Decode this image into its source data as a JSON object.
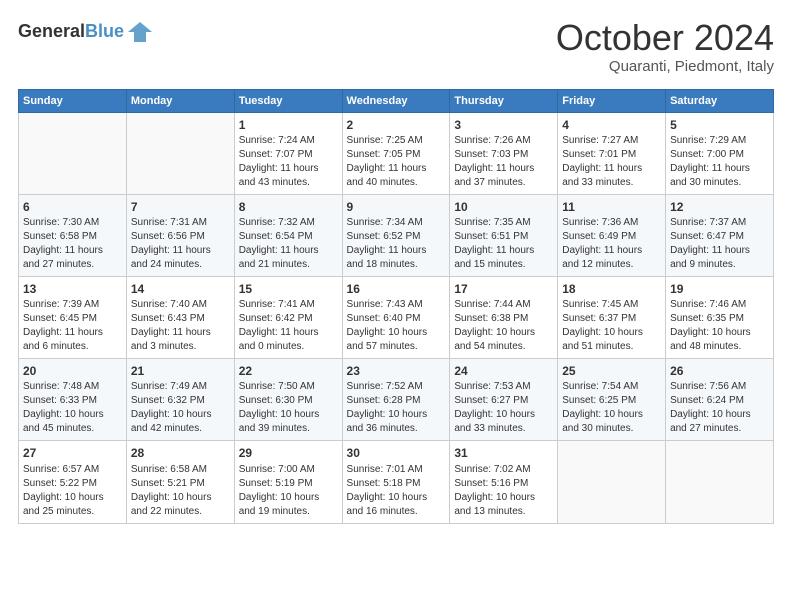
{
  "header": {
    "logo_line1": "General",
    "logo_line2": "Blue",
    "month": "October 2024",
    "location": "Quaranti, Piedmont, Italy"
  },
  "weekdays": [
    "Sunday",
    "Monday",
    "Tuesday",
    "Wednesday",
    "Thursday",
    "Friday",
    "Saturday"
  ],
  "weeks": [
    [
      {
        "day": "",
        "info": ""
      },
      {
        "day": "",
        "info": ""
      },
      {
        "day": "1",
        "info": "Sunrise: 7:24 AM\nSunset: 7:07 PM\nDaylight: 11 hours\nand 43 minutes."
      },
      {
        "day": "2",
        "info": "Sunrise: 7:25 AM\nSunset: 7:05 PM\nDaylight: 11 hours\nand 40 minutes."
      },
      {
        "day": "3",
        "info": "Sunrise: 7:26 AM\nSunset: 7:03 PM\nDaylight: 11 hours\nand 37 minutes."
      },
      {
        "day": "4",
        "info": "Sunrise: 7:27 AM\nSunset: 7:01 PM\nDaylight: 11 hours\nand 33 minutes."
      },
      {
        "day": "5",
        "info": "Sunrise: 7:29 AM\nSunset: 7:00 PM\nDaylight: 11 hours\nand 30 minutes."
      }
    ],
    [
      {
        "day": "6",
        "info": "Sunrise: 7:30 AM\nSunset: 6:58 PM\nDaylight: 11 hours\nand 27 minutes."
      },
      {
        "day": "7",
        "info": "Sunrise: 7:31 AM\nSunset: 6:56 PM\nDaylight: 11 hours\nand 24 minutes."
      },
      {
        "day": "8",
        "info": "Sunrise: 7:32 AM\nSunset: 6:54 PM\nDaylight: 11 hours\nand 21 minutes."
      },
      {
        "day": "9",
        "info": "Sunrise: 7:34 AM\nSunset: 6:52 PM\nDaylight: 11 hours\nand 18 minutes."
      },
      {
        "day": "10",
        "info": "Sunrise: 7:35 AM\nSunset: 6:51 PM\nDaylight: 11 hours\nand 15 minutes."
      },
      {
        "day": "11",
        "info": "Sunrise: 7:36 AM\nSunset: 6:49 PM\nDaylight: 11 hours\nand 12 minutes."
      },
      {
        "day": "12",
        "info": "Sunrise: 7:37 AM\nSunset: 6:47 PM\nDaylight: 11 hours\nand 9 minutes."
      }
    ],
    [
      {
        "day": "13",
        "info": "Sunrise: 7:39 AM\nSunset: 6:45 PM\nDaylight: 11 hours\nand 6 minutes."
      },
      {
        "day": "14",
        "info": "Sunrise: 7:40 AM\nSunset: 6:43 PM\nDaylight: 11 hours\nand 3 minutes."
      },
      {
        "day": "15",
        "info": "Sunrise: 7:41 AM\nSunset: 6:42 PM\nDaylight: 11 hours\nand 0 minutes."
      },
      {
        "day": "16",
        "info": "Sunrise: 7:43 AM\nSunset: 6:40 PM\nDaylight: 10 hours\nand 57 minutes."
      },
      {
        "day": "17",
        "info": "Sunrise: 7:44 AM\nSunset: 6:38 PM\nDaylight: 10 hours\nand 54 minutes."
      },
      {
        "day": "18",
        "info": "Sunrise: 7:45 AM\nSunset: 6:37 PM\nDaylight: 10 hours\nand 51 minutes."
      },
      {
        "day": "19",
        "info": "Sunrise: 7:46 AM\nSunset: 6:35 PM\nDaylight: 10 hours\nand 48 minutes."
      }
    ],
    [
      {
        "day": "20",
        "info": "Sunrise: 7:48 AM\nSunset: 6:33 PM\nDaylight: 10 hours\nand 45 minutes."
      },
      {
        "day": "21",
        "info": "Sunrise: 7:49 AM\nSunset: 6:32 PM\nDaylight: 10 hours\nand 42 minutes."
      },
      {
        "day": "22",
        "info": "Sunrise: 7:50 AM\nSunset: 6:30 PM\nDaylight: 10 hours\nand 39 minutes."
      },
      {
        "day": "23",
        "info": "Sunrise: 7:52 AM\nSunset: 6:28 PM\nDaylight: 10 hours\nand 36 minutes."
      },
      {
        "day": "24",
        "info": "Sunrise: 7:53 AM\nSunset: 6:27 PM\nDaylight: 10 hours\nand 33 minutes."
      },
      {
        "day": "25",
        "info": "Sunrise: 7:54 AM\nSunset: 6:25 PM\nDaylight: 10 hours\nand 30 minutes."
      },
      {
        "day": "26",
        "info": "Sunrise: 7:56 AM\nSunset: 6:24 PM\nDaylight: 10 hours\nand 27 minutes."
      }
    ],
    [
      {
        "day": "27",
        "info": "Sunrise: 6:57 AM\nSunset: 5:22 PM\nDaylight: 10 hours\nand 25 minutes."
      },
      {
        "day": "28",
        "info": "Sunrise: 6:58 AM\nSunset: 5:21 PM\nDaylight: 10 hours\nand 22 minutes."
      },
      {
        "day": "29",
        "info": "Sunrise: 7:00 AM\nSunset: 5:19 PM\nDaylight: 10 hours\nand 19 minutes."
      },
      {
        "day": "30",
        "info": "Sunrise: 7:01 AM\nSunset: 5:18 PM\nDaylight: 10 hours\nand 16 minutes."
      },
      {
        "day": "31",
        "info": "Sunrise: 7:02 AM\nSunset: 5:16 PM\nDaylight: 10 hours\nand 13 minutes."
      },
      {
        "day": "",
        "info": ""
      },
      {
        "day": "",
        "info": ""
      }
    ]
  ]
}
